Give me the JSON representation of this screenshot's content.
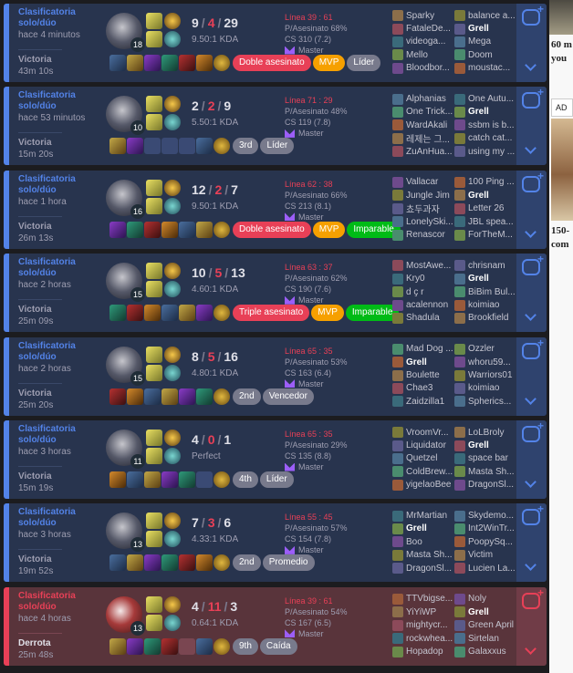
{
  "colors": {
    "win_accent": "#5383e8",
    "loss_accent": "#e84057",
    "win_bg": "#28344e",
    "loss_bg": "#59343b"
  },
  "matches": [
    {
      "result_type": "win",
      "queue": "Clasificatoria solo/dúo",
      "time_ago": "hace 4 minutos",
      "result": "Victoria",
      "duration": "43m 10s",
      "level": "18",
      "kills": "9",
      "deaths": "4",
      "assists": "29",
      "kda_ratio": "9.50:1 KDA",
      "kill_participation": "Línea 39 : 61",
      "p_asesinato": "P/Asesinato 68%",
      "cs": "CS 310 (7.2)",
      "rank": "Master",
      "items": [
        "item-full",
        "item-full",
        "item-full",
        "item-full",
        "item-full",
        "item-full",
        "trinket"
      ],
      "badges": [
        {
          "label": "Doble asesinato",
          "color": "red"
        },
        {
          "label": "MVP",
          "color": "gold"
        },
        {
          "label": "Líder",
          "color": "grey"
        }
      ],
      "team1": [
        "Sparky",
        "FataleDe...",
        "videoga...",
        "Mello",
        "Bloodbor..."
      ],
      "team2": [
        "balance a...",
        "Grell",
        "Mega",
        "Doom",
        "moustac..."
      ],
      "me_team": 2,
      "me_index": 1
    },
    {
      "result_type": "win",
      "queue": "Clasificatoria solo/dúo",
      "time_ago": "hace 53 minutos",
      "result": "Victoria",
      "duration": "15m 20s",
      "level": "10",
      "kills": "2",
      "deaths": "2",
      "assists": "9",
      "kda_ratio": "5.50:1 KDA",
      "kill_participation": "Línea 71 : 29",
      "p_asesinato": "P/Asesinato 48%",
      "cs": "CS 119 (7.8)",
      "rank": "Master",
      "items": [
        "item-full",
        "item-full",
        "empty",
        "empty",
        "empty",
        "item-full",
        "trinket"
      ],
      "badges": [
        {
          "label": "3rd",
          "color": "grey"
        },
        {
          "label": "Líder",
          "color": "grey"
        }
      ],
      "team1": [
        "Alphanias",
        "One Trick...",
        "WardAkali",
        "레제는 그...",
        "ZuAnHua..."
      ],
      "team2": [
        "One Autu...",
        "Grell",
        "ssbm is b...",
        "catch cat...",
        "using my ..."
      ],
      "me_team": 2,
      "me_index": 1
    },
    {
      "result_type": "win",
      "queue": "Clasificatoria solo/dúo",
      "time_ago": "hace 1 hora",
      "result": "Victoria",
      "duration": "26m 13s",
      "level": "16",
      "kills": "12",
      "deaths": "2",
      "assists": "7",
      "kda_ratio": "9.50:1 KDA",
      "kill_participation": "Línea 62 : 38",
      "p_asesinato": "P/Asesinato 66%",
      "cs": "CS 213 (8.1)",
      "rank": "Master",
      "items": [
        "item-full",
        "item-full",
        "item-full",
        "item-full",
        "item-full",
        "item-full",
        "trinket"
      ],
      "badges": [
        {
          "label": "Doble asesinato",
          "color": "red"
        },
        {
          "label": "MVP",
          "color": "gold"
        },
        {
          "label": "Imparable",
          "color": "green"
        }
      ],
      "team1": [
        "Vallacar",
        "Jungle Jim",
        "쵸두과자",
        "LonelySki...",
        "Renascor"
      ],
      "team2": [
        "100 Ping ...",
        "Grell",
        "Letter 26",
        "JBL spea...",
        "ForTheM..."
      ],
      "me_team": 2,
      "me_index": 1
    },
    {
      "result_type": "win",
      "queue": "Clasificatoria solo/dúo",
      "time_ago": "hace 2 horas",
      "result": "Victoria",
      "duration": "25m 09s",
      "level": "15",
      "kills": "10",
      "deaths": "5",
      "assists": "13",
      "kda_ratio": "4.60:1 KDA",
      "kill_participation": "Línea 63 : 37",
      "p_asesinato": "P/Asesinato 62%",
      "cs": "CS 190 (7.6)",
      "rank": "Master",
      "items": [
        "item-full",
        "item-full",
        "item-full",
        "item-full",
        "item-full",
        "item-full",
        "trinket"
      ],
      "badges": [
        {
          "label": "Triple asesinato",
          "color": "red"
        },
        {
          "label": "MVP",
          "color": "gold"
        },
        {
          "label": "Imparable",
          "color": "green"
        }
      ],
      "team1": [
        "MostAwe...",
        "Kry0",
        "d ҫ r",
        "acalennon",
        "Shadula"
      ],
      "team2": [
        "chrisnam",
        "Grell",
        "BiBim Bul...",
        "koimiao",
        "Brookfield"
      ],
      "me_team": 2,
      "me_index": 1
    },
    {
      "result_type": "win",
      "queue": "Clasificatoria solo/dúo",
      "time_ago": "hace 2 horas",
      "result": "Victoria",
      "duration": "25m 20s",
      "level": "15",
      "kills": "8",
      "deaths": "5",
      "assists": "16",
      "kda_ratio": "4.80:1 KDA",
      "kill_participation": "Línea 65 : 35",
      "p_asesinato": "P/Asesinato 53%",
      "cs": "CS 163 (6.4)",
      "rank": "Master",
      "items": [
        "item-full",
        "item-full",
        "item-full",
        "item-full",
        "item-full",
        "item-full",
        "trinket"
      ],
      "badges": [
        {
          "label": "2nd",
          "color": "grey"
        },
        {
          "label": "Vencedor",
          "color": "grey"
        }
      ],
      "team1": [
        "Mad Dog ...",
        "Grell",
        "Boulette",
        "Chae3",
        "Zaidzilla1"
      ],
      "team2": [
        "Ozzler",
        "whoru59...",
        "Warriors01",
        "koimiao",
        "Spherics..."
      ],
      "me_team": 1,
      "me_index": 1
    },
    {
      "result_type": "win",
      "queue": "Clasificatoria solo/dúo",
      "time_ago": "hace 3 horas",
      "result": "Victoria",
      "duration": "15m 19s",
      "level": "11",
      "kills": "4",
      "deaths": "0",
      "assists": "1",
      "kda_ratio": "Perfect",
      "kill_participation": "Línea 65 : 35",
      "p_asesinato": "P/Asesinato 29%",
      "cs": "CS 135 (8.8)",
      "rank": "Master",
      "items": [
        "item-full",
        "item-full",
        "item-full",
        "item-full",
        "item-full",
        "empty",
        "trinket"
      ],
      "badges": [
        {
          "label": "4th",
          "color": "grey"
        },
        {
          "label": "Líder",
          "color": "grey"
        }
      ],
      "team1": [
        "VroomVr...",
        "Liquidator",
        "Quetzel",
        "ColdBrew...",
        "yigelaoBee"
      ],
      "team2": [
        "LoLBroly",
        "Grell",
        "space bar",
        "Masta Sh...",
        "DragonSl..."
      ],
      "me_team": 2,
      "me_index": 1
    },
    {
      "result_type": "win",
      "queue": "Clasificatoria solo/dúo",
      "time_ago": "hace 3 horas",
      "result": "Victoria",
      "duration": "19m 52s",
      "level": "13",
      "kills": "7",
      "deaths": "3",
      "assists": "6",
      "kda_ratio": "4.33:1 KDA",
      "kill_participation": "Línea 55 : 45",
      "p_asesinato": "P/Asesinato 57%",
      "cs": "CS 154 (7.8)",
      "rank": "Master",
      "items": [
        "item-full",
        "item-full",
        "item-full",
        "item-full",
        "item-full",
        "item-full",
        "trinket"
      ],
      "badges": [
        {
          "label": "2nd",
          "color": "grey"
        },
        {
          "label": "Promedio",
          "color": "grey"
        }
      ],
      "team1": [
        "MrMartian",
        "Grell",
        "Boo",
        "Masta Sh...",
        "DragonSl..."
      ],
      "team2": [
        "Skydemo...",
        "Int2WinTr...",
        "PoopySq...",
        "Victim",
        "Lucien La..."
      ],
      "me_team": 1,
      "me_index": 1
    },
    {
      "result_type": "loss",
      "queue": "Clasificatoria solo/dúo",
      "time_ago": "hace 4 horas",
      "result": "Derrota",
      "duration": "25m 48s",
      "level": "13",
      "kills": "4",
      "deaths": "11",
      "assists": "3",
      "kda_ratio": "0.64:1 KDA",
      "kill_participation": "Línea 39 : 61",
      "p_asesinato": "P/Asesinato 54%",
      "cs": "CS 167 (6.5)",
      "rank": "Master",
      "items": [
        "item-full",
        "item-full",
        "item-full",
        "item-full",
        "empty",
        "item-full",
        "trinket"
      ],
      "badges": [
        {
          "label": "9th",
          "color": "grey"
        },
        {
          "label": "Caída",
          "color": "grey"
        }
      ],
      "team1": [
        "TTVbigse...",
        "YiYiWP",
        "mightycr...",
        "rockwhea...",
        "Hopadop"
      ],
      "team2": [
        "Noly",
        "Grell",
        "Green April",
        "Sirtelan",
        "Galaxxus"
      ],
      "me_team": 2,
      "me_index": 1
    }
  ],
  "sidebar": {
    "text1": "60 m",
    "text1b": "you",
    "ad_label": "AD",
    "text2": "150-",
    "text2b": "com"
  }
}
